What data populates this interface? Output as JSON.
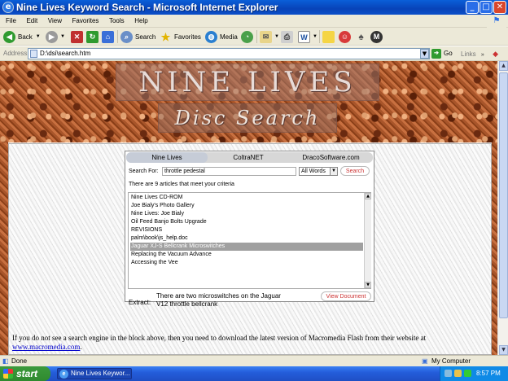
{
  "window": {
    "title": "Nine Lives Keyword Search - Microsoft Internet Explorer"
  },
  "menu": [
    "File",
    "Edit",
    "View",
    "Favorites",
    "Tools",
    "Help"
  ],
  "toolbar": {
    "back": "Back",
    "search": "Search",
    "favorites": "Favorites",
    "media": "Media"
  },
  "address": {
    "label": "Address",
    "url": "D:\\dsi\\search.htm",
    "go": "Go",
    "links": "Links"
  },
  "page": {
    "logo_top": "NINE LIVES",
    "logo_bottom": "Disc Search",
    "tabs": [
      "Nine Lives",
      "ColtraNET",
      "DracoSoftware.com"
    ],
    "search_label": "Search For:",
    "search_value": "throttle pedestal",
    "match_mode": "All Words",
    "search_button": "Search",
    "found_text": "There are 9 articles that meet your criteria",
    "results": [
      "Nine Lives CD-ROM",
      "Joe Bialy's Photo Gallery",
      "Nine Lives: Joe Bialy",
      "Oil Feed Banjo Bolts Upgrade",
      "REVISIONS",
      "palm\\book\\js_help.doc",
      "Jaguar XJ-S Bellcrank Microswitches",
      "Replacing the Vacuum Advance",
      "Accessing the Vee"
    ],
    "selected_index": 6,
    "extract_label": "Extract:",
    "extract_text": "There are two microswitches on the Jaguar V12 throttle bellcrank",
    "view_document": "View Document",
    "note_text": "If you do not see a search engine in the block above, then you need to download the latest version of Macromedia Flash from their website at",
    "note_link": "www.macromedia.com",
    "note_end": "."
  },
  "status": {
    "left": "Done",
    "zone": "My Computer"
  },
  "taskbar": {
    "start": "start",
    "task": "Nine Lives Keywor...",
    "clock": "8:57 PM"
  },
  "colors": {
    "titlebar": "#0a4fc9",
    "selection": "#a0a0a0",
    "accent_red": "#c33333",
    "link": "#0000cc"
  }
}
